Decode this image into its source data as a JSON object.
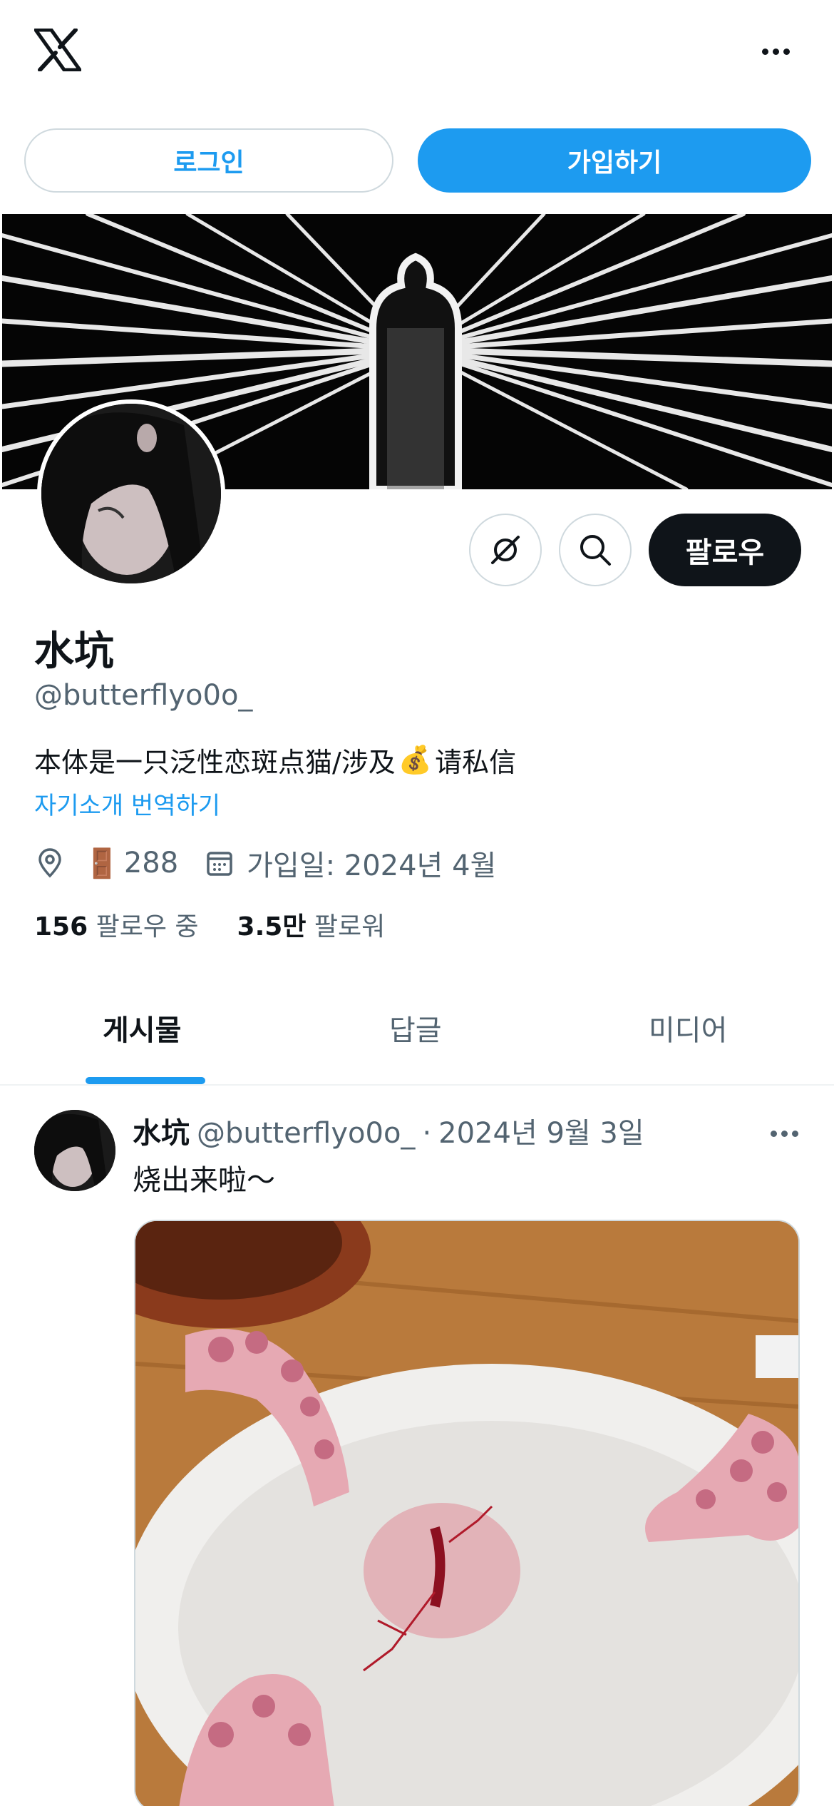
{
  "header": {
    "logo_icon": "x-logo-icon",
    "more_icon": "more-horizontal-icon"
  },
  "auth": {
    "login_label": "로그인",
    "signup_label": "가입하기"
  },
  "profile": {
    "name": "水坑",
    "handle": "@butterflyo0o_",
    "bio_prefix": "本体是一只泛性恋斑点猫/涉及",
    "bio_emoji": "💰",
    "bio_suffix": "请私信",
    "translate_label": "자기소개 번역하기",
    "location_icon": "location-pin-icon",
    "location_emoji": "🚪",
    "location_text": "288",
    "calendar_icon": "calendar-icon",
    "joined": "가입일: 2024년 4월",
    "following_count": "156",
    "following_label": "팔로우 중",
    "followers_count": "3.5만",
    "followers_label": "팔로워",
    "follow_label": "팔로우",
    "grok_icon": "grok-icon",
    "search_icon": "search-icon"
  },
  "tabs": [
    {
      "label": "게시물",
      "active": true
    },
    {
      "label": "답글",
      "active": false
    },
    {
      "label": "미디어",
      "active": false
    }
  ],
  "post": {
    "author": "水坑",
    "handle": "@butterflyo0o_",
    "separator": "·",
    "date": "2024년 9월 3일",
    "text": "烧出来啦～",
    "more_icon": "more-horizontal-icon"
  },
  "colors": {
    "accent": "#1d9bf0",
    "text_primary": "#0f1419",
    "text_secondary": "#536471",
    "border": "#cfd9de"
  }
}
